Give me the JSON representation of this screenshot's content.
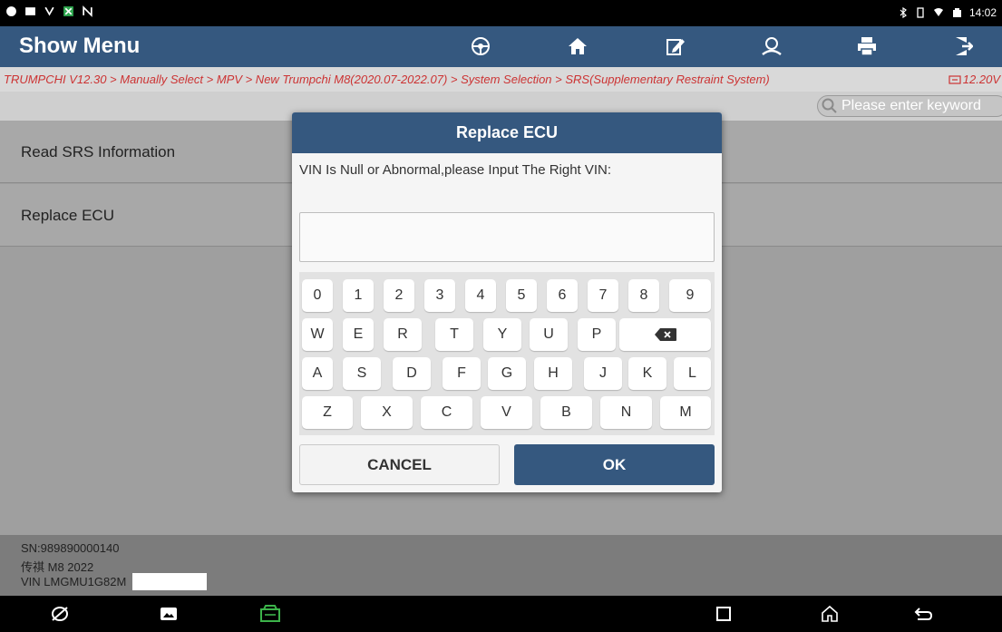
{
  "status_bar": {
    "time": "14:02"
  },
  "app_bar": {
    "title": "Show Menu",
    "tools": [
      "steering-wheel-icon",
      "home-icon",
      "edit-icon",
      "user-icon",
      "print-icon",
      "exit-icon"
    ]
  },
  "breadcrumb": {
    "path": "TRUMPCHI V12.30 > Manually Select > MPV > New Trumpchi M8(2020.07-2022.07) > System Selection > SRS(Supplementary Restraint System)",
    "voltage": "12.20V"
  },
  "search": {
    "placeholder": "Please enter keyword"
  },
  "menu": [
    {
      "label": "Read SRS Information"
    },
    {
      "label": "Replace ECU"
    }
  ],
  "footer": {
    "sn": "SN:989890000140",
    "vehicle": "传祺 M8 2022",
    "vin": "VIN LMGMU1G82M"
  },
  "dialog": {
    "title": "Replace ECU",
    "message": "VIN Is Null or Abnormal,please Input The Right VIN:",
    "input_value": "",
    "keys_row1": [
      "0",
      "1",
      "2",
      "3",
      "4",
      "5",
      "6",
      "7",
      "8",
      "9"
    ],
    "keys_row2": [
      "W",
      "E",
      "R",
      "T",
      "Y",
      "U",
      "P"
    ],
    "keys_row3": [
      "A",
      "S",
      "D",
      "F",
      "G",
      "H",
      "J",
      "K",
      "L"
    ],
    "keys_row4": [
      "Z",
      "X",
      "C",
      "V",
      "B",
      "N",
      "M"
    ],
    "cancel_label": "CANCEL",
    "ok_label": "OK"
  },
  "colors": {
    "primary": "#35587f",
    "breadcrumb_text": "#cc3333"
  }
}
